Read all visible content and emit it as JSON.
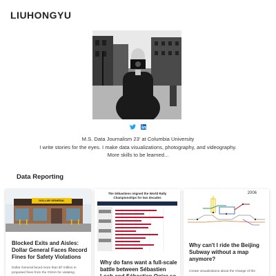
{
  "header": {
    "site_title": "LIUHONGYU"
  },
  "profile": {
    "photo_alt": "Portrait photo",
    "social": [
      {
        "name": "twitter",
        "color": "#1da1f2"
      },
      {
        "name": "linkedin",
        "color": "#0a66c2"
      }
    ],
    "bio_lines": [
      "M.S. Data Journalism 23' at Columbia University",
      "I write stories for the eyes. I make data visualizations, photography, and videography.",
      "More skills to be learned..."
    ]
  },
  "data_reporting": {
    "heading": "Data Reporting",
    "cards": [
      {
        "title": "Blocked Exits and Aisles: Dollar General Faces Record Fines for Safety Violations",
        "excerpt": "Dollar General faced more than $7 million in proposed fines from the OSHA for violating",
        "thumb_sign": "DOLLAR GENERAL"
      },
      {
        "title": "Why do fans want a full-scale battle between Sébastien Loeb and Sébastien Ogier so",
        "excerpt": "",
        "thumb_title": "The Sébastiens reigned the World Rally Championships for two decades"
      },
      {
        "title": "Why can't I ride the Beijing Subway without a map anymore?",
        "excerpt": "Create visualizations about the change of the",
        "thumb_year": "2006"
      }
    ]
  },
  "colors": {
    "accent": "#c8102e",
    "text": "#222222",
    "link": "#1da1f2"
  }
}
